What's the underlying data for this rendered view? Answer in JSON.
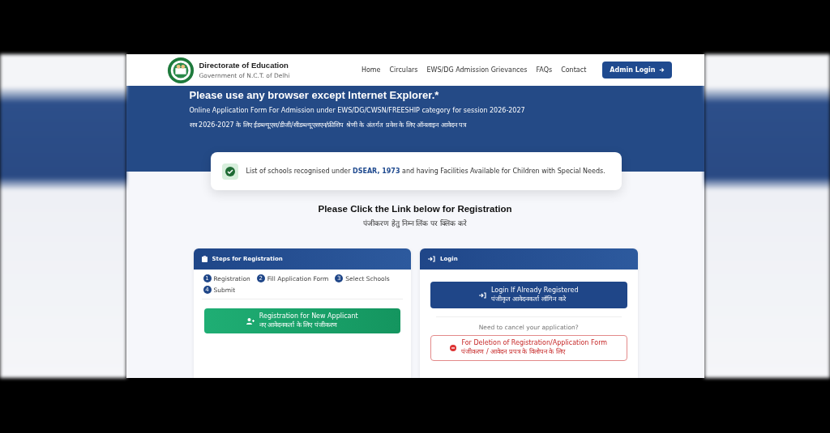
{
  "header": {
    "title": "Directorate of Education",
    "subtitle": "Government of N.C.T. of Delhi",
    "nav": [
      {
        "label": "Home"
      },
      {
        "label": "Circulars"
      },
      {
        "label": "EWS/DG Admission Grievances"
      },
      {
        "label": "FAQs"
      },
      {
        "label": "Contact"
      }
    ],
    "admin_button": "Admin Login"
  },
  "hero": {
    "heading": "Please use any browser except Internet Explorer.*",
    "line_en": "Online Application Form For Admission under EWS/DG/CWSN/FREESHIP category for session 2026-2027",
    "line_hi": "सत्र 2026-2027 के लिए ईडब्ल्यूएस/डीजी/सीडब्ल्यूएसएन/फ्रीशिप श्रेणी के अंतर्गत प्रवेश के लिए ऑनलाइन आवेदन पत्र"
  },
  "notice": {
    "before": "List of schools recognised under",
    "link": "DSEAR, 1973",
    "after": "and having Facilities Available for Children with Special Needs."
  },
  "section": {
    "title": "Please Click the Link below for Registration",
    "subtitle": "पंजीकरण हेतु निम्न लिंक पर क्लिक करे"
  },
  "steps_card": {
    "title": "Steps for Registration",
    "steps": [
      {
        "num": "1",
        "label": "Registration"
      },
      {
        "num": "2",
        "label": "Fill Application Form"
      },
      {
        "num": "3",
        "label": "Select Schools"
      },
      {
        "num": "4",
        "label": "Submit"
      }
    ],
    "button": {
      "line_en": "Registration for New Applicant",
      "line_hi": "नए आवेदनकर्ता के लिए पंजीकरण"
    }
  },
  "login_card": {
    "title": "Login",
    "button": {
      "line_en": "Login If Already Registered",
      "line_hi": "पंजीकृत आवेदनकर्ता लॉगिन करे"
    },
    "cancel_prompt": "Need to cancel your application?",
    "delete_button": {
      "line_en": "For Deletion of Registration/Application Form",
      "line_hi": "पंजीकरण / आवेदन प्रपत्र के विलोपन के लिए"
    }
  }
}
